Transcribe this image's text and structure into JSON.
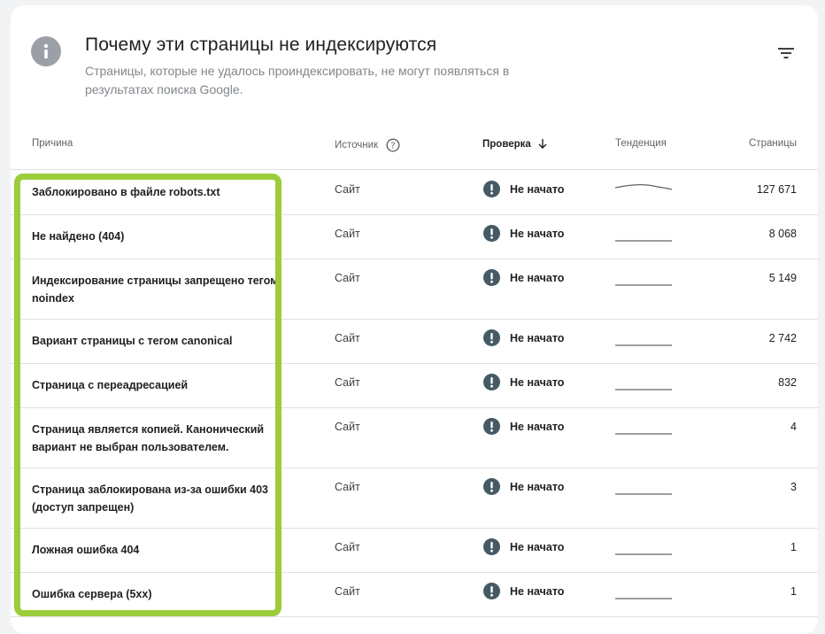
{
  "header": {
    "title": "Почему эти страницы не индексируются",
    "subtitle": "Страницы, которые не удалось проиндексировать, не могут появляться в результатах поиска Google."
  },
  "columns": {
    "reason": "Причина",
    "source": "Источник",
    "check": "Проверка",
    "trend": "Тенденция",
    "pages": "Страницы"
  },
  "rows": [
    {
      "reason": "Заблокировано в файле robots.txt",
      "source": "Сайт",
      "status": "Не начато",
      "pages": "127 671",
      "trend": "curve"
    },
    {
      "reason": "Не найдено (404)",
      "source": "Сайт",
      "status": "Не начато",
      "pages": "8 068",
      "trend": "flat"
    },
    {
      "reason": "Индексирование страницы запрещено тегом noindex",
      "source": "Сайт",
      "status": "Не начато",
      "pages": "5 149",
      "trend": "flat"
    },
    {
      "reason": "Вариант страницы с тегом canonical",
      "source": "Сайт",
      "status": "Не начато",
      "pages": "2 742",
      "trend": "flat"
    },
    {
      "reason": "Страница с переадресацией",
      "source": "Сайт",
      "status": "Не начато",
      "pages": "832",
      "trend": "flat"
    },
    {
      "reason": "Страница является копией. Канонический вариант не выбран пользователем.",
      "source": "Сайт",
      "status": "Не начато",
      "pages": "4",
      "trend": "flat"
    },
    {
      "reason": "Страница заблокирована из-за ошибки 403 (доступ запрещен)",
      "source": "Сайт",
      "status": "Не начато",
      "pages": "3",
      "trend": "flat"
    },
    {
      "reason": "Ложная ошибка 404",
      "source": "Сайт",
      "status": "Не начато",
      "pages": "1",
      "trend": "flat"
    },
    {
      "reason": "Ошибка сервера (5xx)",
      "source": "Сайт",
      "status": "Не начато",
      "pages": "1",
      "trend": "flat"
    }
  ],
  "icons": {
    "info": "info-icon",
    "filter": "filter-icon",
    "help": "help-icon",
    "sort": "arrow-down-icon",
    "status": "exclamation-icon"
  },
  "colors": {
    "highlight": "#9ccc3a",
    "status_dot": "#455a64",
    "info_icon": "#9aa0a6"
  }
}
